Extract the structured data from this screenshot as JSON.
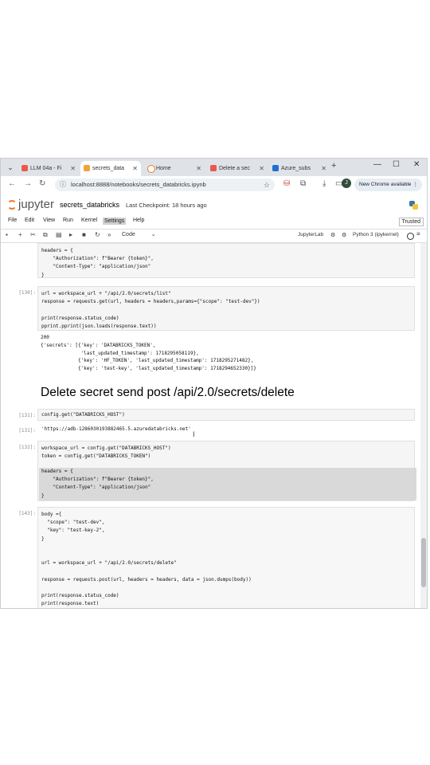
{
  "browser": {
    "tabs": [
      {
        "title": "LLM 04a - Fi",
        "color": "#e8584f",
        "active": false
      },
      {
        "title": "secrets_data",
        "color": "#f3a23a",
        "active": true
      },
      {
        "title": "Home",
        "color": "#f37726",
        "active": false
      },
      {
        "title": "Delete a sec",
        "color": "#e8584f",
        "active": false
      },
      {
        "title": "Azure_subs",
        "color": "#1f6fd1",
        "active": false
      }
    ],
    "new_tab": "+",
    "url": "localhost:8888/notebooks/secrets_databricks.ipynb",
    "profile_initial": "J",
    "chrome_badge": "New Chrome available",
    "window_controls": {
      "minimize": "—",
      "maximize": "☐",
      "close": "✕"
    }
  },
  "jupyter": {
    "logo_text": "jupyter",
    "notebook_name": "secrets_databricks",
    "checkpoint": "Last Checkpoint: 18 hours ago",
    "menu": [
      "File",
      "Edit",
      "View",
      "Run",
      "Kernel",
      "Settings",
      "Help"
    ],
    "selected_menu": "Settings",
    "trusted": "Trusted",
    "cell_type": "Code",
    "jupyterlab_link": "JupyterLab",
    "kernel": "Python 3 (ipykernel)"
  },
  "cells": {
    "c0_code": "headers = {\n    \"Authorization\": f\"Bearer {token}\",\n    \"Content-Type\": \"application/json\"\n}",
    "c1_prompt": "[130]:",
    "c1_code": "url = workspace_url + \"/api/2.0/secrets/list\"\nresponse = requests.get(url, headers = headers,params={\"scope\": \"test-dev\"})\n\nprint(response.status_code)\npprint.pprint(json.loads(response.text))",
    "c1_output": "200\n{'secrets': [{'key': 'DATABRICKS_TOKEN',\n              'last_updated_timestamp': 1718295058119},\n             {'key': 'HF_TOKEN', 'last_updated_timestamp': 1718295271482},\n             {'key': 'test-key', 'last_updated_timestamp': 1718294652330}]}",
    "heading": "Delete secret send post /api/2.0/secrets/delete",
    "c2_prompt": "[131]:",
    "c2_code": "config.get(\"DATABRICKS_HOST\")",
    "c2_out_prompt": "[131]:",
    "c2_output": "'https://adb-1286030193882465.5.azuredatabricks.net'",
    "c3_prompt": "[132]:",
    "c3_code_a": "workspace_url = config.get(\"DATABRICKS_HOST\")\ntoken = config.get(\"DATABRICKS_TOKEN\")",
    "c3_code_b": "headers = {\n    \"Authorization\": f\"Bearer {token}\",\n    \"Content-Type\": \"application/json\"\n}",
    "c4_prompt": "[143]:",
    "c4_code": "body ={\n  \"scope\": \"test-dev\",\n  \"key\": \"test-key-2\",\n}\n\n\nurl = workspace_url + \"/api/2.0/secrets/delete\"\n\nresponse = requests.post(url, headers = headers, data = json.dumps(body))\n\nprint(response.status_code)\nprint(response.text)"
  },
  "colors": {
    "jupyter_orange": "#f37726",
    "code_bg": "#f5f5f5",
    "selection": "#d9d9d9"
  }
}
